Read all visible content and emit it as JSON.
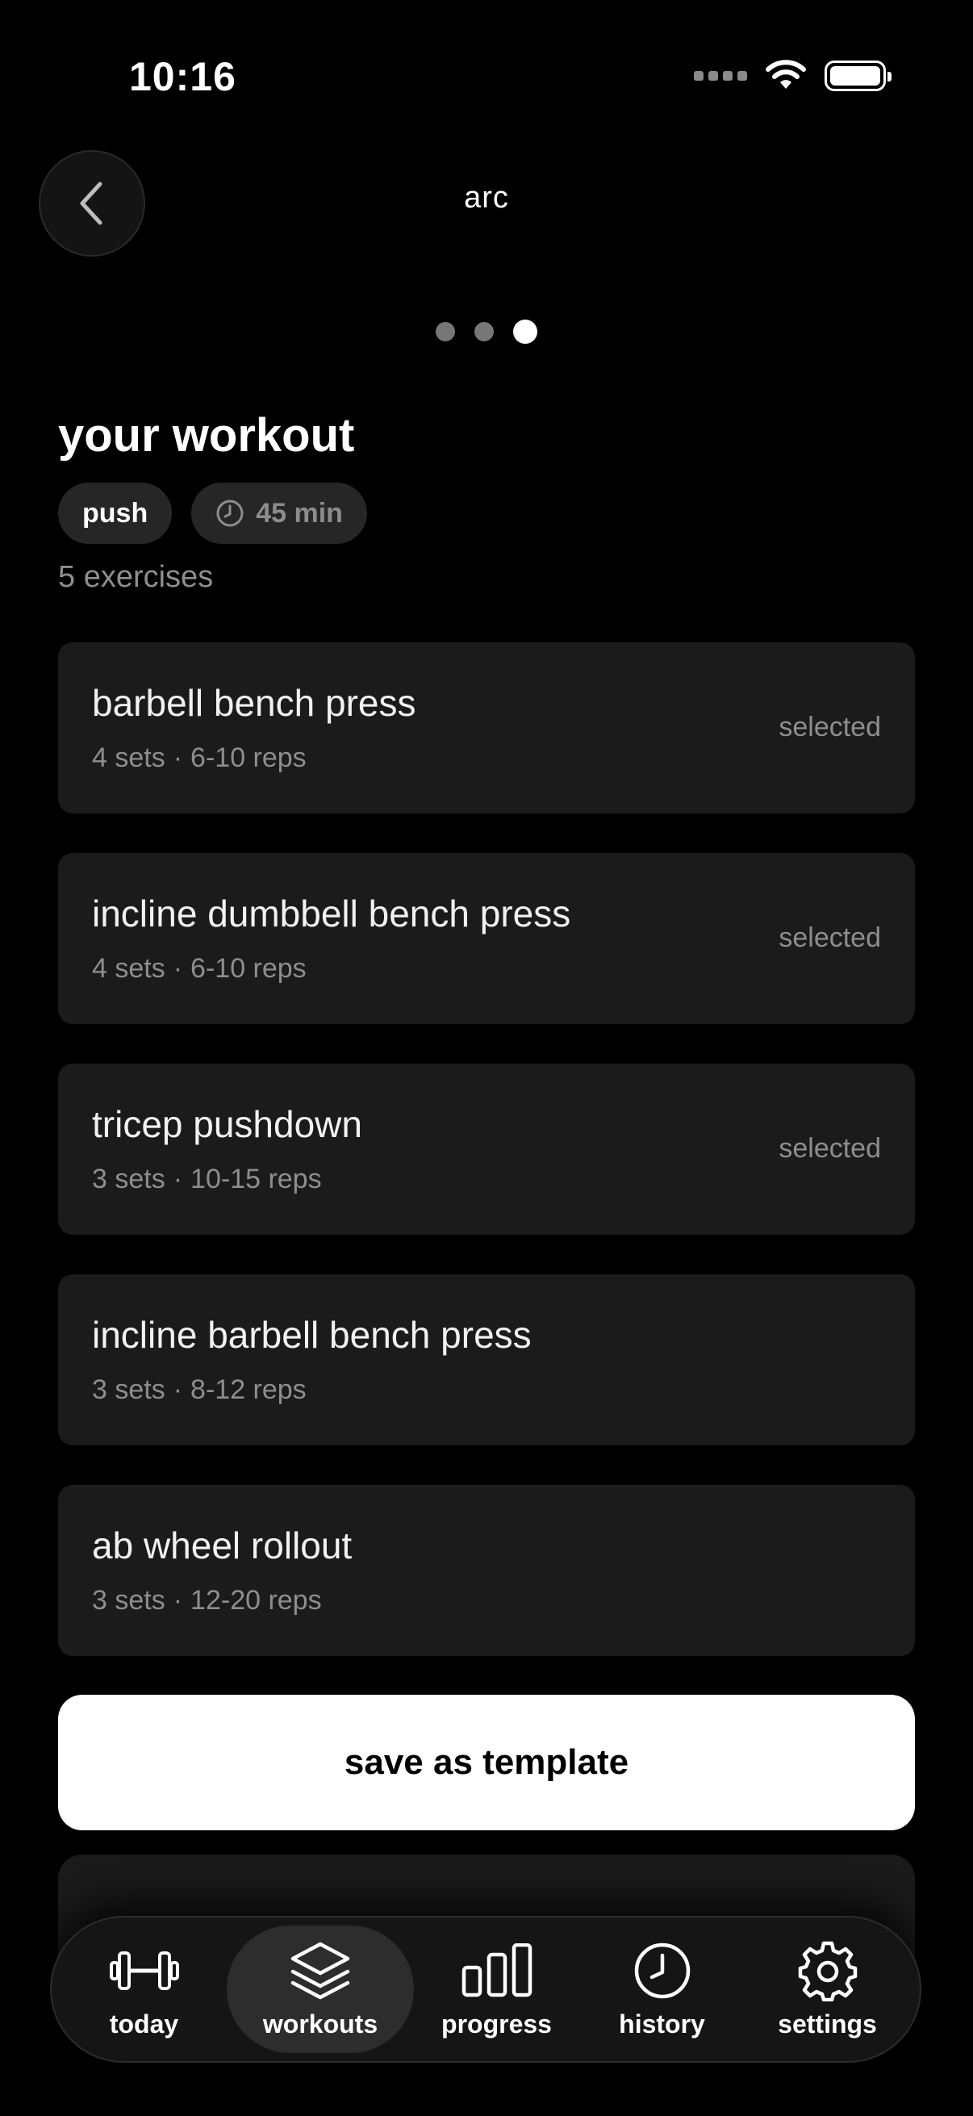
{
  "status_bar": {
    "time": "10:16"
  },
  "header": {
    "logo": "arc",
    "pager": {
      "count": 3,
      "active_index": 2
    }
  },
  "workout": {
    "title": "your workout",
    "split_chip": "push",
    "duration_chip": "45 min",
    "count_label": "5 exercises"
  },
  "exercises": [
    {
      "name": "barbell bench press",
      "sets": "4 sets",
      "reps": "6-10 reps",
      "status": "selected"
    },
    {
      "name": "incline dumbbell bench press",
      "sets": "4 sets",
      "reps": "6-10 reps",
      "status": "selected"
    },
    {
      "name": "tricep pushdown",
      "sets": "3 sets",
      "reps": "10-15 reps",
      "status": "selected"
    },
    {
      "name": "incline barbell bench press",
      "sets": "3 sets",
      "reps": "8-12 reps",
      "status": ""
    },
    {
      "name": "ab wheel rollout",
      "sets": "3 sets",
      "reps": "12-20 reps",
      "status": ""
    }
  ],
  "actions": {
    "save_label": "save as template",
    "secondary_label": ""
  },
  "tabbar": {
    "items": [
      {
        "label": "today",
        "icon": "dumbbell-icon",
        "active": false
      },
      {
        "label": "workouts",
        "icon": "layers-icon",
        "active": true
      },
      {
        "label": "progress",
        "icon": "bar-chart-icon",
        "active": false
      },
      {
        "label": "history",
        "icon": "clock-icon",
        "active": false
      },
      {
        "label": "settings",
        "icon": "gear-icon",
        "active": false
      }
    ]
  }
}
